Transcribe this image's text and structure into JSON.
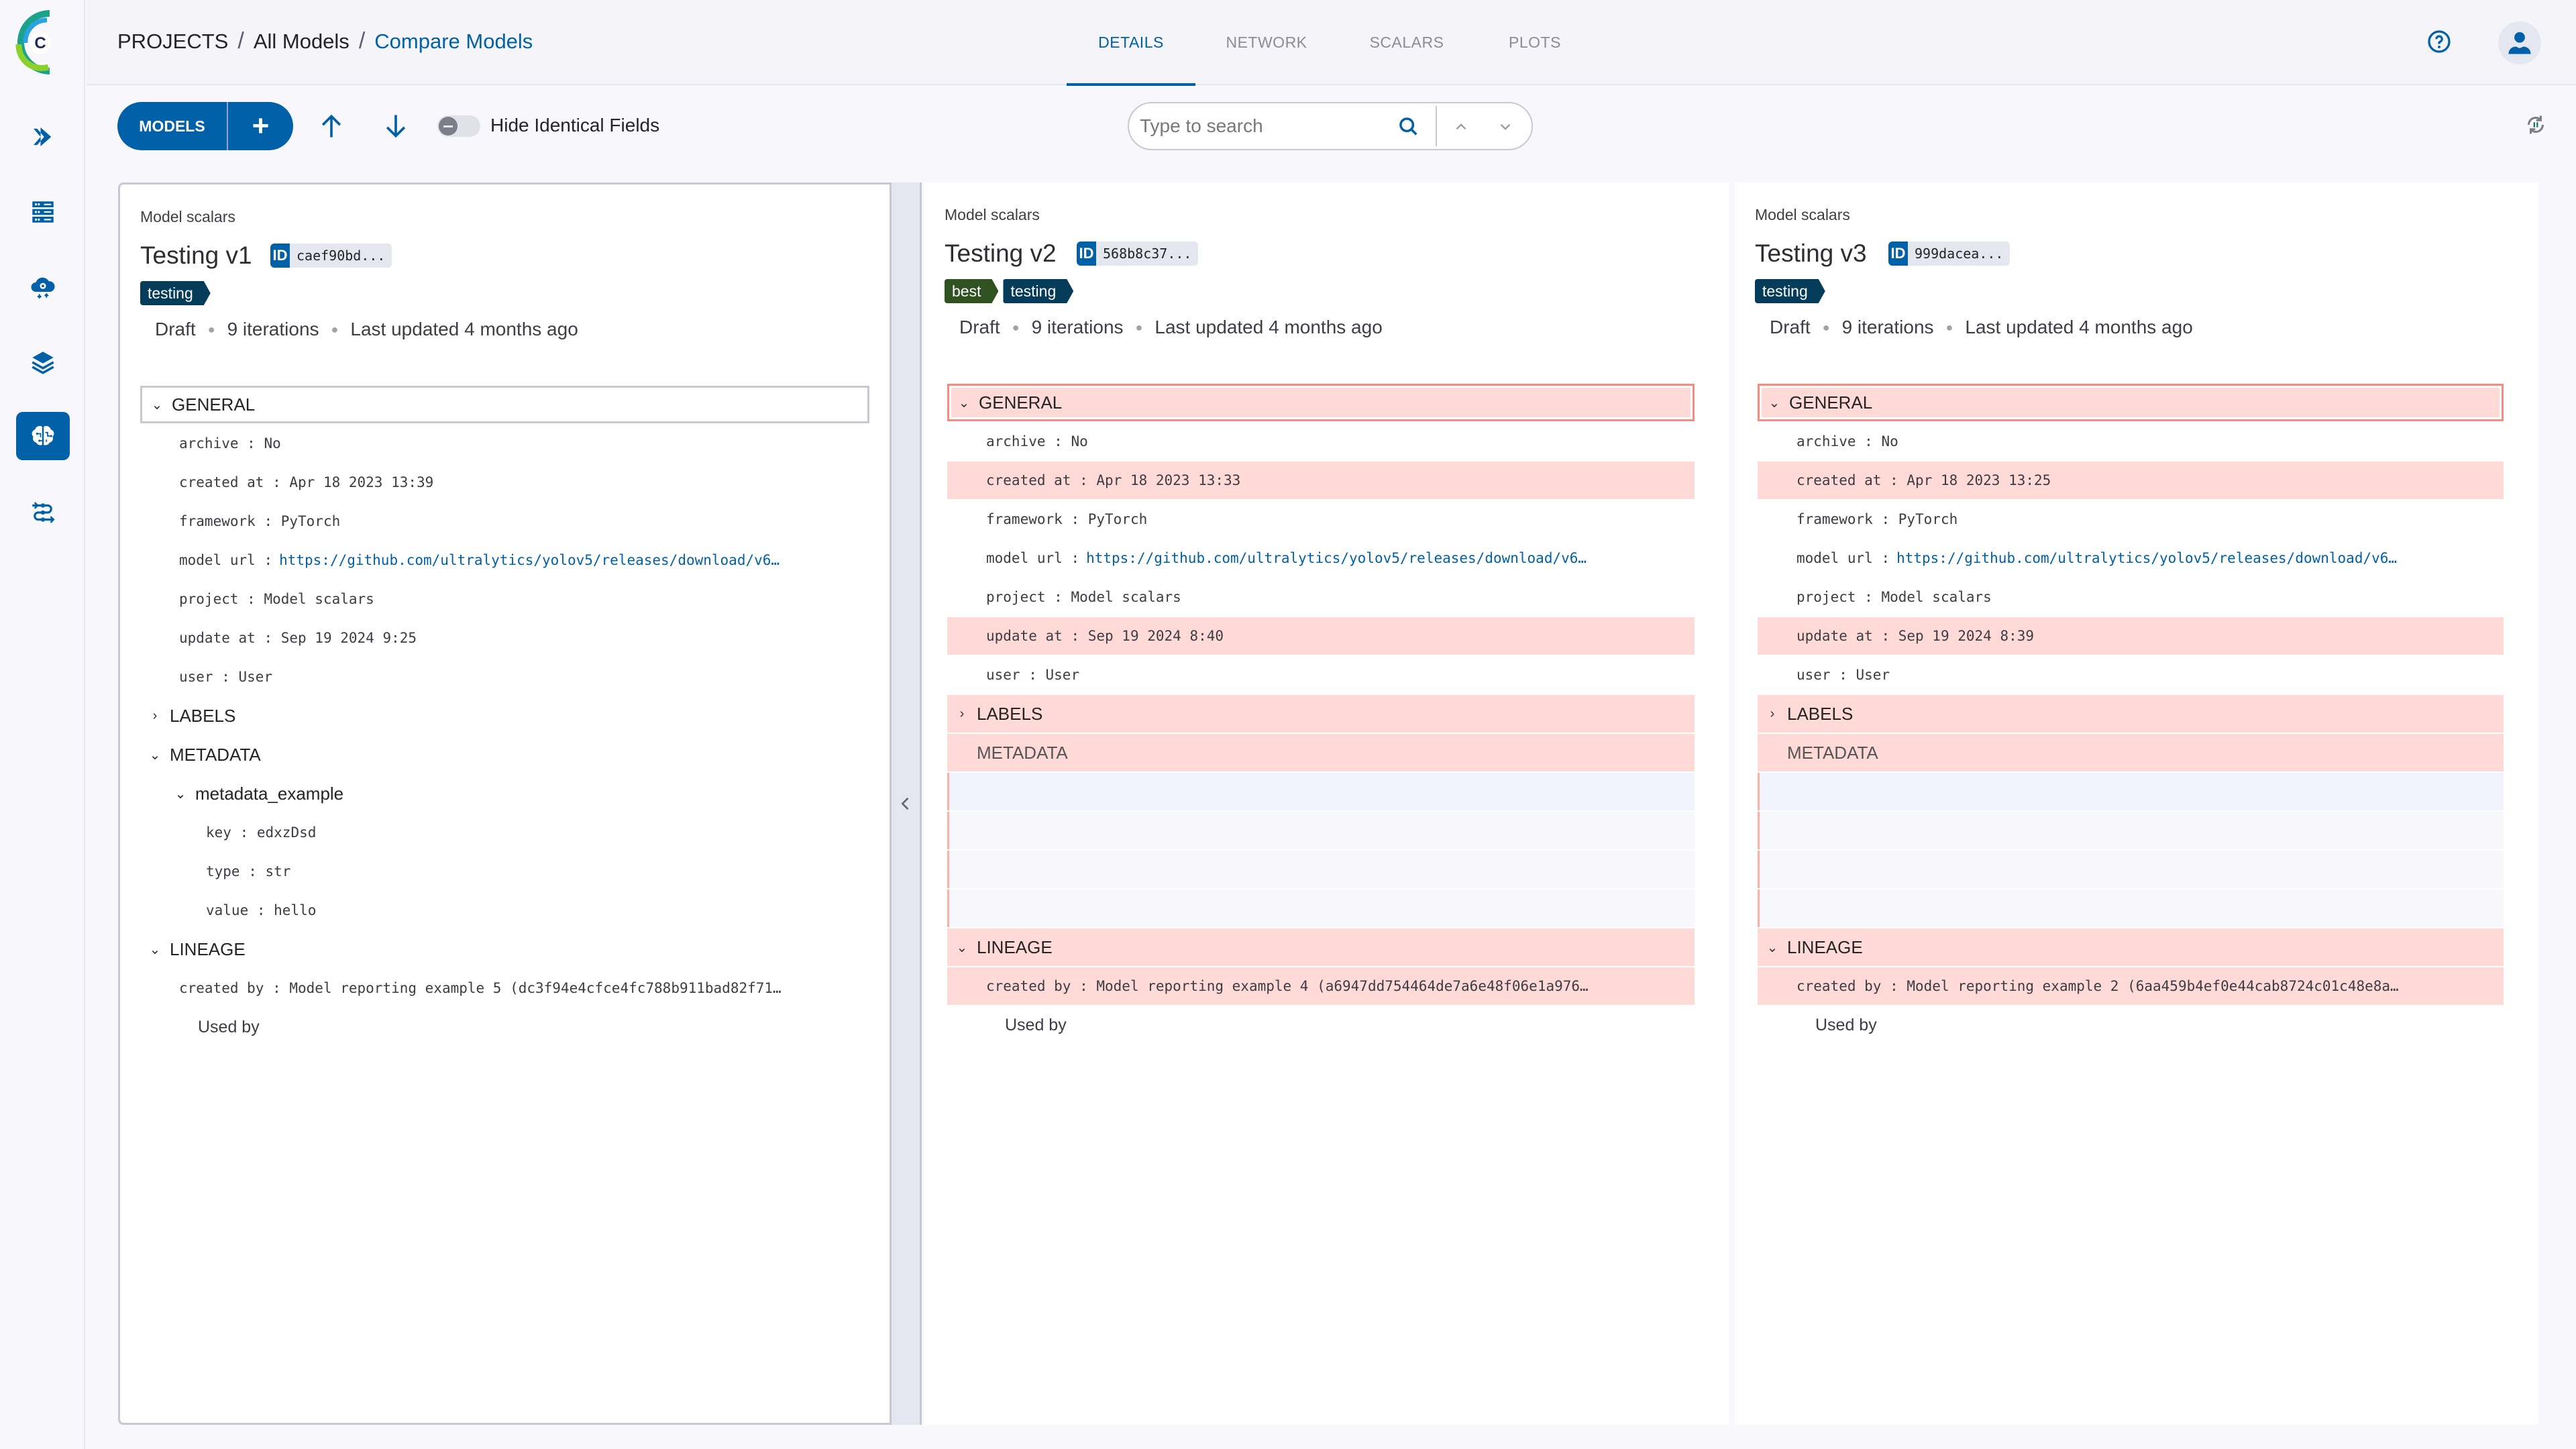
{
  "header": {
    "breadcrumb": [
      "PROJECTS",
      "All Models",
      "Compare Models"
    ],
    "tabs": [
      {
        "label": "DETAILS",
        "active": true
      },
      {
        "label": "NETWORK",
        "active": false
      },
      {
        "label": "SCALARS",
        "active": false
      },
      {
        "label": "PLOTS",
        "active": false
      }
    ]
  },
  "sidebar": {
    "items": [
      {
        "icon": "pipelines-icon",
        "active": false
      },
      {
        "icon": "datasets-icon",
        "active": false
      },
      {
        "icon": "orchestration-icon",
        "active": false
      },
      {
        "icon": "projects-layers-icon",
        "active": false
      },
      {
        "icon": "models-brain-icon",
        "active": true
      },
      {
        "icon": "workflows-icon",
        "active": false
      }
    ]
  },
  "toolbar": {
    "models_label": "MODELS",
    "add_label": "+",
    "hide_identical_label": "Hide Identical Fields",
    "hide_identical_on": false,
    "search_placeholder": "Type to search",
    "search_value": ""
  },
  "colors": {
    "accent": "#0061a8",
    "diff_bg": "#ffdad6",
    "diff_border": "#f48d80",
    "tag_testing": "#043c5a",
    "tag_best": "#2f5220"
  },
  "models": [
    {
      "project": "Model scalars",
      "name": "Testing v1",
      "id_label": "ID",
      "id": "caef90bd...",
      "tags": [
        {
          "label": "testing",
          "color": "#043c5a"
        }
      ],
      "status": "Draft",
      "iterations": "9 iterations",
      "updated": "Last updated 4 months ago",
      "sections": {
        "general": "GENERAL",
        "labels": "LABELS",
        "metadata": "METADATA",
        "lineage": "LINEAGE"
      },
      "general": [
        {
          "key": "archive",
          "value": "No",
          "diff": false
        },
        {
          "key": "created at",
          "value": "Apr 18 2023 13:39",
          "diff": false
        },
        {
          "key": "framework",
          "value": "PyTorch",
          "diff": false
        },
        {
          "key": "model url",
          "value": "https://github.com/ultralytics/yolov5/releases/download/v6…",
          "link": true,
          "diff": false
        },
        {
          "key": "project",
          "value": "Model scalars",
          "diff": false
        },
        {
          "key": "update at",
          "value": "Sep 19 2024 9:25",
          "diff": false
        },
        {
          "key": "user",
          "value": "User",
          "diff": false
        }
      ],
      "metadata_group": "metadata_example",
      "metadata": [
        {
          "key": "key",
          "value": "edxzDsd"
        },
        {
          "key": "type",
          "value": "str"
        },
        {
          "key": "value",
          "value": "hello"
        }
      ],
      "lineage": {
        "created_by_key": "created by",
        "created_by": "Model reporting example 5 (dc3f94e4cfce4fc788b911bad82f71…",
        "used_by": "Used by"
      }
    },
    {
      "project": "Model scalars",
      "name": "Testing v2",
      "id_label": "ID",
      "id": "568b8c37...",
      "tags": [
        {
          "label": "best",
          "color": "#2f5220"
        },
        {
          "label": "testing",
          "color": "#043c5a"
        }
      ],
      "status": "Draft",
      "iterations": "9 iterations",
      "updated": "Last updated 4 months ago",
      "sections": {
        "general": "GENERAL",
        "labels": "LABELS",
        "metadata": "METADATA",
        "lineage": "LINEAGE"
      },
      "general": [
        {
          "key": "archive",
          "value": "No",
          "diff": false
        },
        {
          "key": "created at",
          "value": "Apr 18 2023 13:33",
          "diff": true
        },
        {
          "key": "framework",
          "value": "PyTorch",
          "diff": false
        },
        {
          "key": "model url",
          "value": "https://github.com/ultralytics/yolov5/releases/download/v6…",
          "link": true,
          "diff": false
        },
        {
          "key": "project",
          "value": "Model scalars",
          "diff": false
        },
        {
          "key": "update at",
          "value": "Sep 19 2024 8:40",
          "diff": true
        },
        {
          "key": "user",
          "value": "User",
          "diff": false
        }
      ],
      "lineage": {
        "created_by_key": "created by",
        "created_by": "Model reporting example 4 (a6947dd754464de7a6e48f06e1a976…",
        "used_by": "Used by"
      }
    },
    {
      "project": "Model scalars",
      "name": "Testing v3",
      "id_label": "ID",
      "id": "999dacea...",
      "tags": [
        {
          "label": "testing",
          "color": "#043c5a"
        }
      ],
      "status": "Draft",
      "iterations": "9 iterations",
      "updated": "Last updated 4 months ago",
      "sections": {
        "general": "GENERAL",
        "labels": "LABELS",
        "metadata": "METADATA",
        "lineage": "LINEAGE"
      },
      "general": [
        {
          "key": "archive",
          "value": "No",
          "diff": false
        },
        {
          "key": "created at",
          "value": "Apr 18 2023 13:25",
          "diff": true
        },
        {
          "key": "framework",
          "value": "PyTorch",
          "diff": false
        },
        {
          "key": "model url",
          "value": "https://github.com/ultralytics/yolov5/releases/download/v6…",
          "link": true,
          "diff": false
        },
        {
          "key": "project",
          "value": "Model scalars",
          "diff": false
        },
        {
          "key": "update at",
          "value": "Sep 19 2024 8:39",
          "diff": true
        },
        {
          "key": "user",
          "value": "User",
          "diff": false
        }
      ],
      "lineage": {
        "created_by_key": "created by",
        "created_by": "Model reporting example 2 (6aa459b4ef0e44cab8724c01c48e8a…",
        "used_by": "Used by"
      }
    }
  ]
}
